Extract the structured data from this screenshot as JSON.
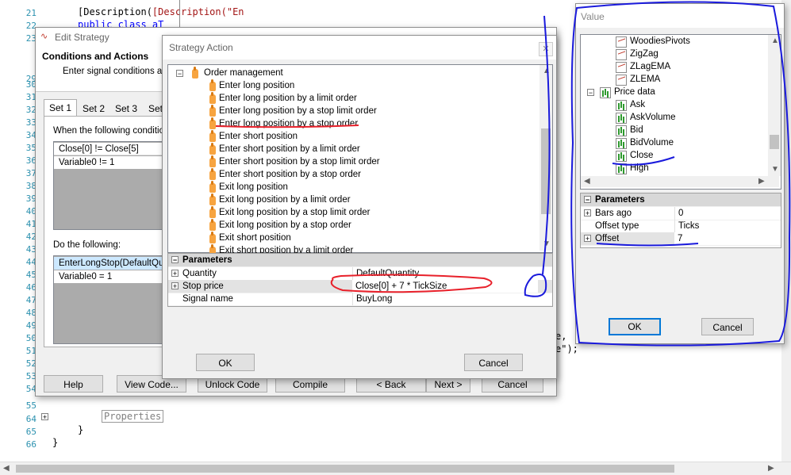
{
  "editor": {
    "line_numbers": [
      "21",
      "22",
      "23",
      "29",
      "30",
      "31",
      "32",
      "33",
      "34",
      "35",
      "36",
      "37",
      "38",
      "39",
      "40",
      "41",
      "42",
      "43",
      "44",
      "45",
      "46",
      "47",
      "48",
      "49",
      "50",
      "51",
      "52",
      "53",
      "54",
      "55",
      "64",
      "65",
      "66"
    ],
    "code_line_21": "[Description(\"En",
    "code_line_22": "public class aT",
    "properties_label": "Properties",
    "brace_64": "}",
    "brace_65": "}",
    "right_fragment_1": "e,",
    "right_fragment_2": "e\");"
  },
  "edit_strategy": {
    "title": "Edit Strategy",
    "heading": "Conditions and Actions",
    "subheading": "Enter signal conditions and",
    "tabs": [
      "Set 1",
      "Set 2",
      "Set 3",
      "Set"
    ],
    "conditions_label": "When the following condition",
    "conditions": [
      "Close[0] != Close[5]",
      "Variable0 != 1"
    ],
    "actions_label": "Do the following:",
    "actions": [
      "EnterLongStop(DefaultQua",
      "Variable0 = 1"
    ],
    "buttons": {
      "help": "Help",
      "view_code": "View Code...",
      "unlock_code": "Unlock Code",
      "compile": "Compile",
      "back": "< Back",
      "next": "Next >",
      "cancel": "Cancel"
    }
  },
  "strategy_action": {
    "title": "Strategy Action",
    "category": "Order management",
    "items": [
      "Enter long position",
      "Enter long position by a limit order",
      "Enter long position by a stop limit order",
      "Enter long position by a stop order",
      "Enter short position",
      "Enter short position by a limit order",
      "Enter short position by a stop limit order",
      "Enter short position by a stop order",
      "Exit long position",
      "Exit long position by a limit order",
      "Exit long position by a stop limit order",
      "Exit long position by a stop order",
      "Exit short position",
      "Exit short position by a limit order"
    ],
    "parameters_header": "Parameters",
    "parameters": [
      {
        "name": "Quantity",
        "value": "DefaultQuantity"
      },
      {
        "name": "Stop price",
        "value": "Close[0] + 7 * TickSize"
      },
      {
        "name": "Signal name",
        "value": "BuyLong"
      }
    ],
    "ok_label": "OK",
    "cancel_label": "Cancel"
  },
  "value_dialog": {
    "title": "Value",
    "indicators": [
      "WoodiesPivots",
      "ZigZag",
      "ZLagEMA",
      "ZLEMA"
    ],
    "group": "Price data",
    "price_items": [
      "Ask",
      "AskVolume",
      "Bid",
      "BidVolume",
      "Close",
      "High"
    ],
    "parameters_header": "Parameters",
    "parameters": [
      {
        "name": "Bars ago",
        "value": "0"
      },
      {
        "name": "Offset type",
        "value": "Ticks"
      },
      {
        "name": "Offset",
        "value": "7"
      }
    ],
    "ok_label": "OK",
    "cancel_label": "Cancel"
  },
  "colors": {
    "annotation_red": "#e8202a",
    "annotation_blue": "#1a1adc",
    "selection": "#cce8ff",
    "accent": "#0078d7"
  }
}
